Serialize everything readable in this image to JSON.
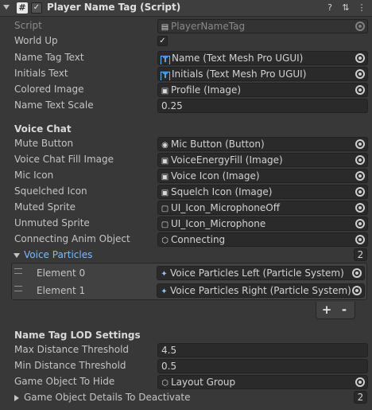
{
  "header": {
    "title": "Player Name Tag (Script)",
    "script_icon": "#",
    "enabled_mark": "✓",
    "help_icon": "?",
    "settings_icon": "⇅",
    "menu_icon": "⋮"
  },
  "fields": {
    "script": {
      "label": "Script",
      "value": "PlayerNameTag"
    },
    "world_up": {
      "label": "World Up",
      "checked": "✓"
    },
    "name_tag_text": {
      "label": "Name Tag Text",
      "value": "Name (Text Mesh Pro UGUI)",
      "icon": "T"
    },
    "initials_text": {
      "label": "Initials Text",
      "value": "Initials (Text Mesh Pro UGUI)",
      "icon": "T"
    },
    "colored_image": {
      "label": "Colored Image",
      "value": "Profile (Image)"
    },
    "name_text_scale": {
      "label": "Name Text Scale",
      "value": "0.25"
    }
  },
  "voice_chat": {
    "title": "Voice Chat",
    "mute_button": {
      "label": "Mute Button",
      "value": "Mic Button (Button)"
    },
    "voice_chat_fill_image": {
      "label": "Voice Chat Fill Image",
      "value": "VoiceEnergyFill (Image)"
    },
    "mic_icon": {
      "label": "Mic Icon",
      "value": "Voice Icon (Image)"
    },
    "squelched_icon": {
      "label": "Squelched Icon",
      "value": "Squelch Icon (Image)"
    },
    "muted_sprite": {
      "label": "Muted Sprite",
      "value": "UI_Icon_MicrophoneOff"
    },
    "unmuted_sprite": {
      "label": "Unmuted Sprite",
      "value": "UI_Icon_Microphone"
    },
    "connecting_anim_object": {
      "label": "Connecting Anim Object",
      "value": "Connecting"
    },
    "voice_particles": {
      "label": "Voice Particles",
      "count": "2",
      "elements": [
        {
          "label": "Element 0",
          "value": "Voice Particles Left (Particle System)"
        },
        {
          "label": "Element 1",
          "value": "Voice Particles Right (Particle System)"
        }
      ],
      "add_label": "+",
      "remove_label": "-"
    }
  },
  "lod": {
    "title": "Name Tag LOD Settings",
    "max_distance": {
      "label": "Max Distance Threshold",
      "value": "4.5"
    },
    "min_distance": {
      "label": "Min Distance Threshold",
      "value": "0.5"
    },
    "game_object_to_hide": {
      "label": "Game Object To Hide",
      "value": "Layout Group"
    },
    "details_to_deactivate": {
      "label": "Game Object Details To Deactivate",
      "count": "2"
    }
  },
  "colors": {
    "background": "#383838",
    "accent": "#7db9ff",
    "field": "#2a2a2a"
  }
}
